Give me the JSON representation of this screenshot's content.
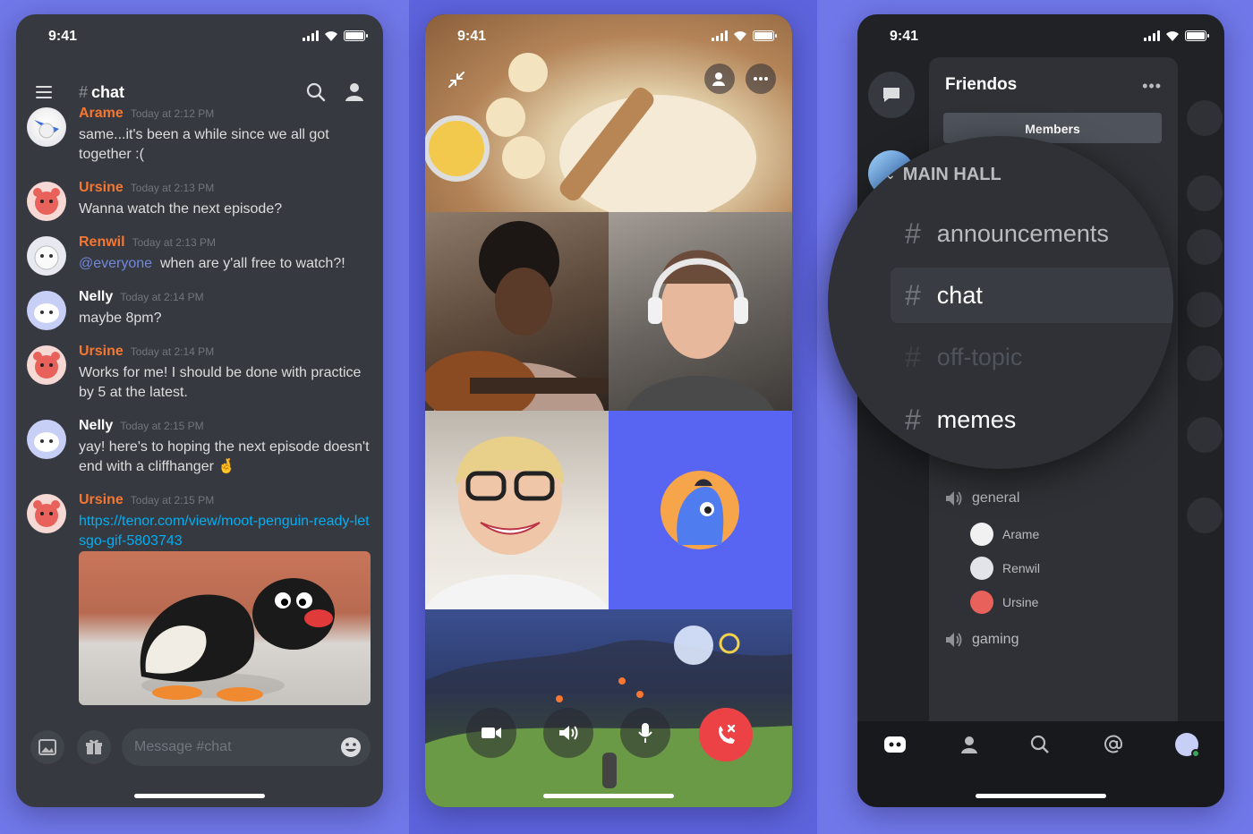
{
  "status_time": "9:41",
  "chat_screen": {
    "channel_name": "chat",
    "messages": [
      {
        "author": "Arame",
        "time": "Today at 2:12 PM",
        "text": "same...it's been a while since we all got together :(",
        "color": "#f57731"
      },
      {
        "author": "Ursine",
        "time": "Today at 2:13 PM",
        "text": "Wanna watch the next episode?",
        "color": "#f57731"
      },
      {
        "author": "Renwil",
        "time": "Today at 2:13 PM",
        "mention": "@everyone",
        "text": "when are y'all free to watch?!",
        "color": "#f57731"
      },
      {
        "author": "Nelly",
        "time": "Today at 2:14 PM",
        "text": "maybe 8pm?",
        "color": "#ffffff"
      },
      {
        "author": "Ursine",
        "time": "Today at 2:14 PM",
        "text": "Works for me! I should be done with practice by 5 at the latest.",
        "color": "#f57731"
      },
      {
        "author": "Nelly",
        "time": "Today at 2:15 PM",
        "text": "yay! here's to hoping the next episode doesn't end with a cliffhanger 🤞",
        "color": "#ffffff"
      },
      {
        "author": "Ursine",
        "time": "Today at 2:15 PM",
        "link": "https://tenor.com/view/moot-penguin-ready-letsgo-gif-5803743",
        "color": "#f57731"
      }
    ],
    "composer_placeholder": "Message #chat"
  },
  "server_screen": {
    "server_name": "Friendos",
    "members_label": "Members",
    "category": "MAIN HALL",
    "text_channels": [
      "announcements",
      "chat",
      "off-topic",
      "memes"
    ],
    "active_channel": "chat",
    "voice_channels": [
      {
        "name": "general",
        "users": [
          "Arame",
          "Renwil",
          "Ursine"
        ]
      },
      {
        "name": "gaming",
        "users": []
      }
    ]
  },
  "colors": {
    "brand": "#5865f2",
    "bg_dark": "#36393f",
    "end_call": "#ed4245",
    "online": "#3ba55d"
  }
}
